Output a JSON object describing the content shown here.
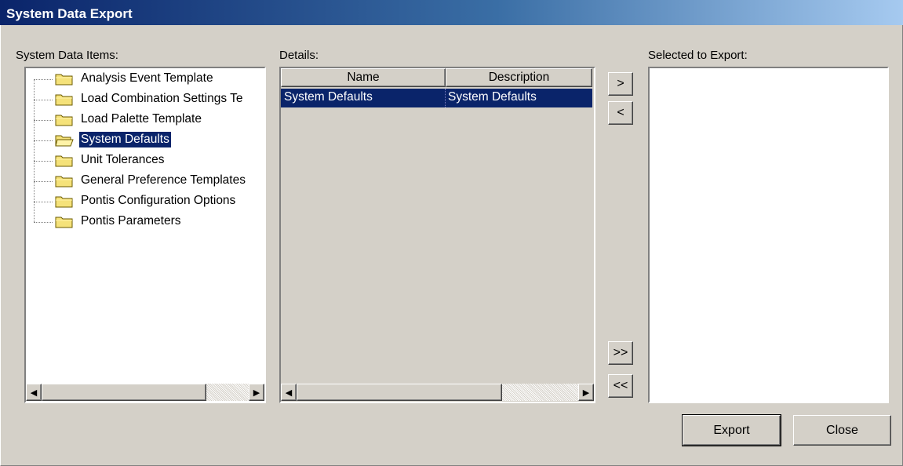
{
  "window": {
    "title": "System Data Export"
  },
  "left_panel": {
    "label": "System Data Items:",
    "items": [
      {
        "label": "Analysis Event Template",
        "icon": "folder-closed-icon",
        "selected": false
      },
      {
        "label": "Load Combination Settings Te",
        "icon": "folder-closed-icon",
        "selected": false
      },
      {
        "label": "Load Palette Template",
        "icon": "folder-closed-icon",
        "selected": false
      },
      {
        "label": "System Defaults",
        "icon": "folder-open-icon",
        "selected": true
      },
      {
        "label": "Unit Tolerances",
        "icon": "folder-closed-icon",
        "selected": false
      },
      {
        "label": "General Preference Templates",
        "icon": "folder-closed-icon",
        "selected": false
      },
      {
        "label": "Pontis Configuration Options",
        "icon": "folder-closed-icon",
        "selected": false
      },
      {
        "label": "Pontis Parameters",
        "icon": "folder-closed-icon",
        "selected": false
      }
    ]
  },
  "details_panel": {
    "label": "Details:",
    "columns": [
      "Name",
      "Description"
    ],
    "rows": [
      {
        "name": "System Defaults",
        "description": "System Defaults",
        "selected": true
      }
    ]
  },
  "transfer_buttons": {
    "add": ">",
    "remove": "<",
    "add_all": ">>",
    "remove_all": "<<"
  },
  "right_panel": {
    "label": "Selected to Export:"
  },
  "actions": {
    "export": "Export",
    "close": "Close"
  },
  "colors": {
    "selection": "#0a246a",
    "face": "#d4d0c8",
    "folder": "#f5e27a"
  }
}
